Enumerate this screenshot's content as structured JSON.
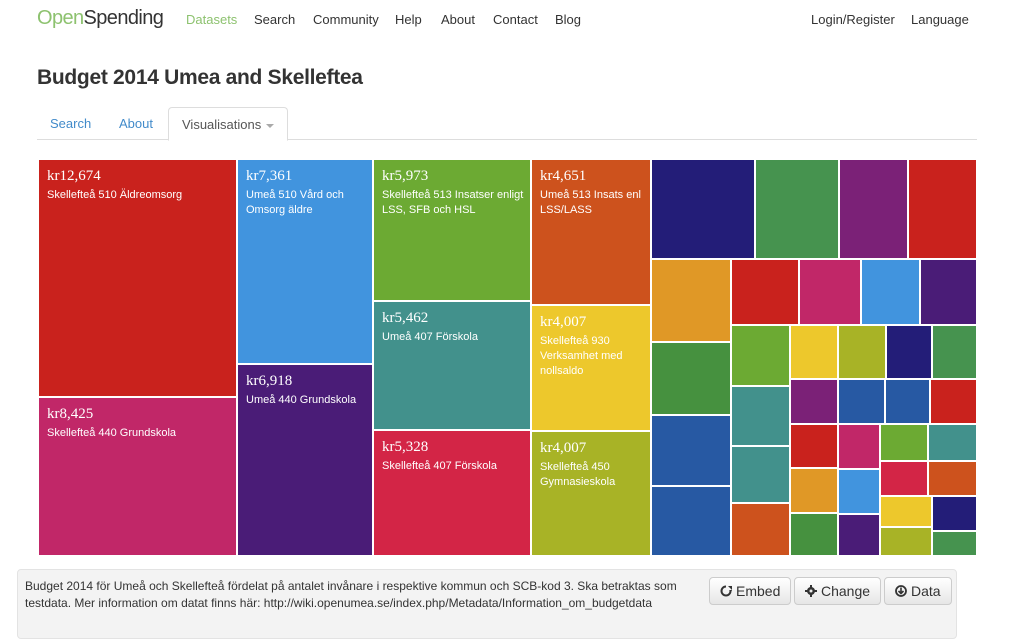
{
  "navbar": {
    "brand_open": "Open",
    "brand_spending": "Spending",
    "links": [
      "Datasets",
      "Search",
      "Community",
      "Help",
      "About",
      "Contact",
      "Blog"
    ],
    "right_links": [
      "Login/Register",
      "Language"
    ],
    "active_link": "Datasets",
    "brand_green": "#8dc26f"
  },
  "page": {
    "title": "Budget 2014 Umea and Skelleftea"
  },
  "tabs": [
    {
      "label": "Search",
      "active": false
    },
    {
      "label": "About",
      "active": false
    },
    {
      "label": "Visualisations",
      "active": true,
      "dropdown": true
    }
  ],
  "treemap": {
    "labeled_tiles": [
      {
        "amount": "kr12,674",
        "label": "Skellefteå 510 Äldreomsorg",
        "color": "#c9221d"
      },
      {
        "amount": "kr8,425",
        "label": "Skellefteå 440 Grundskola",
        "color": "#c12768"
      },
      {
        "amount": "kr7,361",
        "label": "Umeå 510 Vård och Omsorg äldre",
        "color": "#4194de"
      },
      {
        "amount": "kr6,918",
        "label": "Umeå 440 Grundskola",
        "color": "#4a1c77"
      },
      {
        "amount": "kr5,973",
        "label": "Skellefteå 513 Insatser enligt LSS, SFB och HSL",
        "color": "#6caa33"
      },
      {
        "amount": "kr5,462",
        "label": "Umeå 407 Förskola",
        "color": "#42918c"
      },
      {
        "amount": "kr5,328",
        "label": "Skellefteå 407 Förskola",
        "color": "#d32546"
      },
      {
        "amount": "kr4,651",
        "label": "Umeå 513 Insats enl LSS/LASS",
        "color": "#cd521d"
      },
      {
        "amount": "kr4,007",
        "label": "Skellefteå 930 Verksamhet med nollsaldo",
        "color": "#edc82c"
      },
      {
        "amount": "kr4,007",
        "label": "Skellefteå 450 Gymnasieskola",
        "color": "#a8b326"
      }
    ],
    "small_tile_colors": [
      "#231d78",
      "#46934f",
      "#7b2177",
      "#c9221d",
      "#e09826",
      "#c9221d",
      "#c12768",
      "#4194de",
      "#4a1c77",
      "#46913f",
      "#6caa33",
      "#edc82c",
      "#a8b326",
      "#231d78",
      "#46934f",
      "#42918c",
      "#7b2177",
      "#2759a3",
      "#2759a3",
      "#c9221d",
      "#2759a3",
      "#42918c",
      "#c9221d",
      "#c12768",
      "#6caa33",
      "#42918c",
      "#2759a3",
      "#cd521d",
      "#e09826",
      "#4194de",
      "#d32546",
      "#cd521d",
      "#46913f",
      "#4a1c77",
      "#edc82c",
      "#231d78",
      "#a8b326",
      "#46934f"
    ]
  },
  "footer": {
    "description": "Budget 2014 för Umeå och Skellefteå fördelat på antalet invånare i respektive kommun och SCB-kod 3. Ska betraktas som testdata. Mer information om datat finns här: http://wiki.openumea.se/index.php/Metadata/Information_om_budgetdata",
    "buttons": [
      {
        "label": "Embed",
        "icon": "share-icon"
      },
      {
        "label": "Change",
        "icon": "gear-icon"
      },
      {
        "label": "Data",
        "icon": "download-icon"
      }
    ]
  }
}
